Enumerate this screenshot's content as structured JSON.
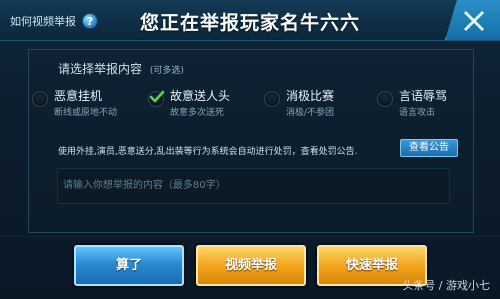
{
  "header": {
    "help_label": "如何视频举报",
    "help_badge": "?",
    "title": "您正在举报玩家名牛六六"
  },
  "section": {
    "heading": "请选择举报内容",
    "note": "(可多选)"
  },
  "options": [
    {
      "label": "恶意挂机",
      "desc": "断线或原地不动",
      "checked": false
    },
    {
      "label": "故意送人头",
      "desc": "故意多次送死",
      "checked": true
    },
    {
      "label": "消极比赛",
      "desc": "消极/不参团",
      "checked": false
    },
    {
      "label": "言语辱骂",
      "desc": "语言攻击",
      "checked": false
    }
  ],
  "notice": {
    "text": "使用外挂,演员,恶意送分,乱出装等行为系统会自动进行处罚，查看处罚公告.",
    "button_label": "查看公告"
  },
  "input": {
    "placeholder": "请输入你想举报的内容（最多80字）"
  },
  "buttons": {
    "cancel": "算了",
    "video_report": "视频举报",
    "quick_report": "快速举报"
  },
  "watermark": "头条号 / 游戏小七",
  "colors": {
    "accent_blue": "#2b89d1",
    "accent_gold": "#f2a51c",
    "check_green": "#58d64b"
  }
}
